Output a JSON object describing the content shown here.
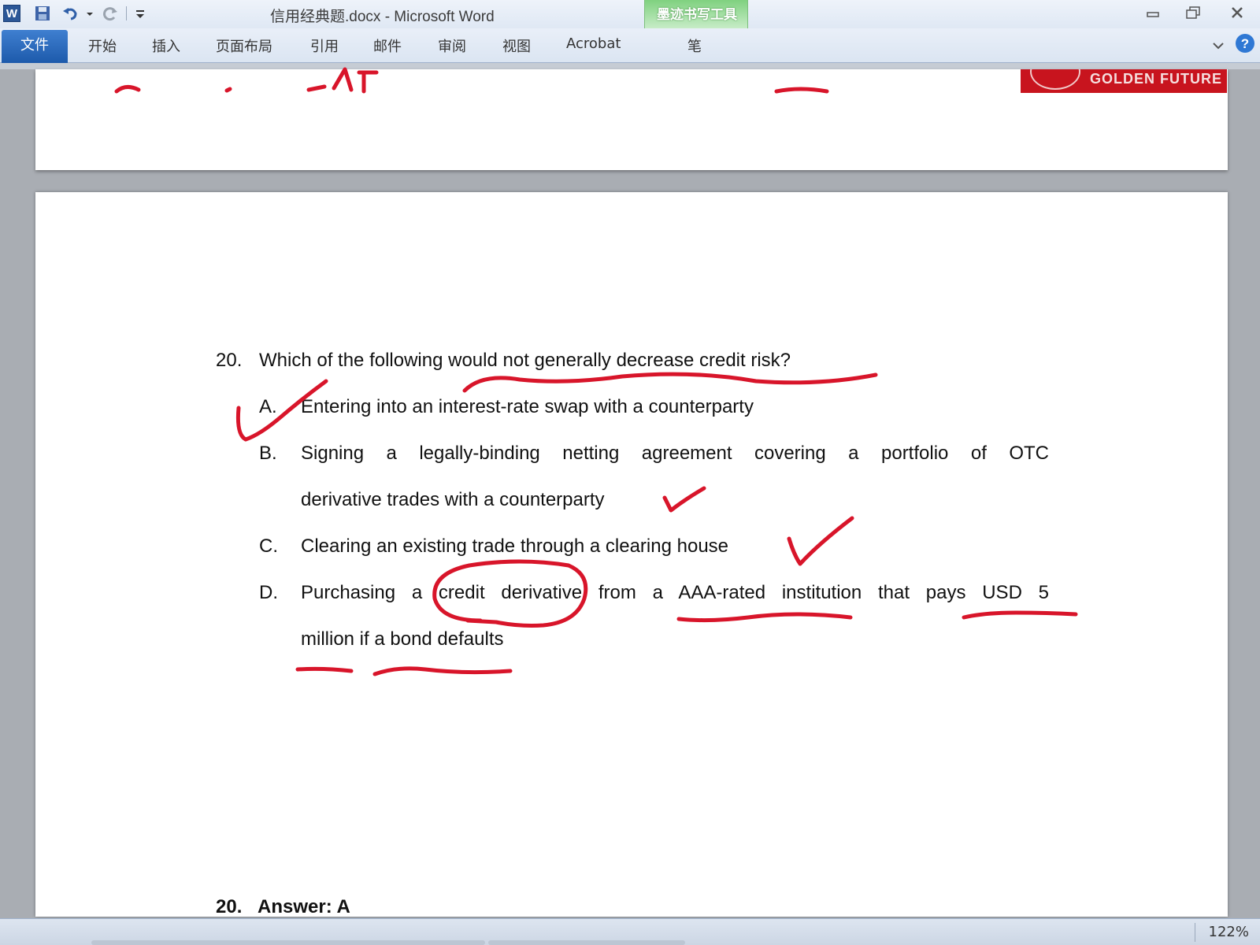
{
  "window": {
    "title": "信用经典题.docx - Microsoft Word",
    "contextual_tab_group": "墨迹书写工具"
  },
  "ribbon": {
    "tabs": [
      "文件",
      "开始",
      "插入",
      "页面布局",
      "引用",
      "邮件",
      "审阅",
      "视图",
      "Acrobat",
      "笔"
    ]
  },
  "header": {
    "brand": "GOLDEN FUTURE"
  },
  "question": {
    "number": "20.",
    "text": "Which of the following would not generally decrease credit risk?",
    "options": [
      {
        "letter": "A.",
        "lines": [
          "Entering into an interest-rate swap with a counterparty"
        ]
      },
      {
        "letter": "B.",
        "lines": [
          "Signing a legally-binding netting agreement covering a portfolio of OTC",
          "derivative trades with a counterparty"
        ]
      },
      {
        "letter": "C.",
        "lines": [
          "Clearing an existing trade through a clearing house"
        ]
      },
      {
        "letter": "D.",
        "lines": [
          "Purchasing a credit derivative from a AAA-rated institution that pays USD 5",
          "million if a bond defaults"
        ]
      }
    ]
  },
  "answer": {
    "number": "20.",
    "label": "Answer: A"
  },
  "status": {
    "zoom": "122%"
  },
  "colors": {
    "ink": "#d8152a",
    "ink_tab": "#7fd17f",
    "file_tab": "#2b66bd",
    "brand": "#c8141e"
  }
}
